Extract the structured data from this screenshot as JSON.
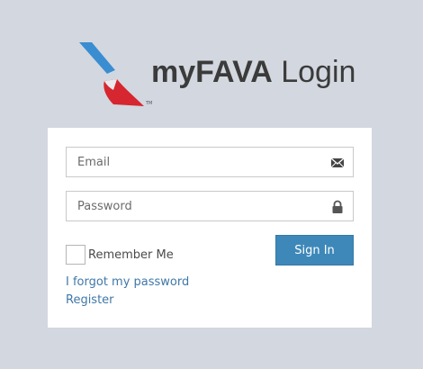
{
  "header": {
    "title_bold": "myFAVA",
    "title_light": "Login",
    "trademark": "TM",
    "logo_icon": "flight-symbol-logo"
  },
  "form": {
    "email_placeholder": "Email",
    "email_icon": "envelope-icon",
    "password_placeholder": "Password",
    "password_icon": "lock-icon",
    "remember_label": "Remember Me",
    "remember_checked": false,
    "signin_label": "Sign In",
    "forgot_label": "I forgot my password",
    "register_label": "Register"
  },
  "colors": {
    "background": "#d3d7df",
    "card": "#ffffff",
    "button": "#3e88b9",
    "link": "#3f78a8"
  }
}
